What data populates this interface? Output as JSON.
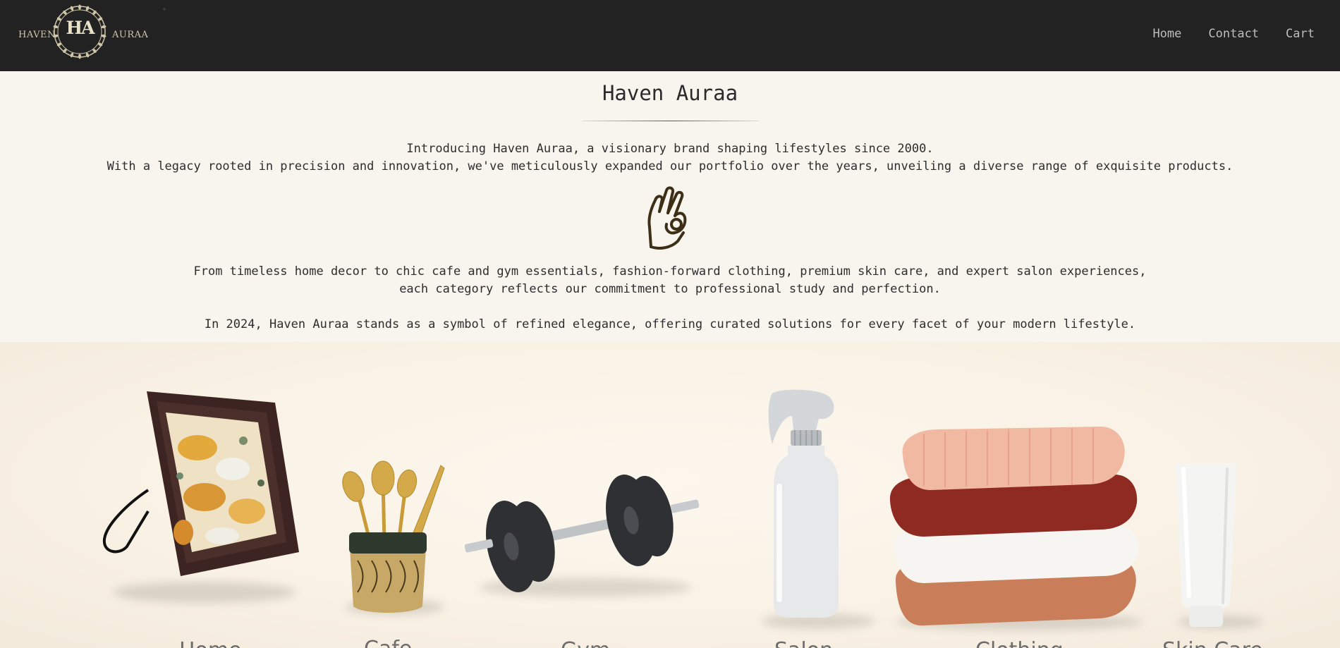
{
  "brand": {
    "left_word": "HAVEN",
    "monogram": "HA",
    "right_word": "AURAA"
  },
  "nav": {
    "items": [
      {
        "label": "Home"
      },
      {
        "label": "Contact"
      },
      {
        "label": "Cart"
      }
    ]
  },
  "intro": {
    "title": "Haven Auraa",
    "paragraph1_line1": "Introducing Haven Auraa, a visionary brand shaping lifestyles since 2000.",
    "paragraph1_line2": "With a legacy rooted in precision and innovation, we've meticulously expanded our portfolio over the years, unveiling a diverse range of exquisite products.",
    "icon": "ok-hand-icon",
    "paragraph2_line1": "From timeless home decor to chic cafe and gym essentials, fashion-forward clothing, premium skin care, and expert salon experiences,",
    "paragraph2_line2": "each category reflects our commitment to professional study and perfection.",
    "paragraph3": "In 2024, Haven Auraa stands as a symbol of refined elegance, offering curated solutions for every facet of your modern lifestyle."
  },
  "categories": [
    {
      "label": "Home",
      "icon": "picture-frame-icon"
    },
    {
      "label": "Cafe",
      "icon": "cutlery-cup-icon"
    },
    {
      "label": "Gym",
      "icon": "dumbbell-icon"
    },
    {
      "label": "Salon",
      "icon": "spray-bottle-icon"
    },
    {
      "label": "Clothing",
      "icon": "folded-clothes-icon"
    },
    {
      "label": "Skin Care",
      "icon": "cream-tube-icon"
    }
  ],
  "colors": {
    "navbar": "#222222",
    "page_bg": "#f8f5ef",
    "accent_gold": "#cfc6a8"
  }
}
